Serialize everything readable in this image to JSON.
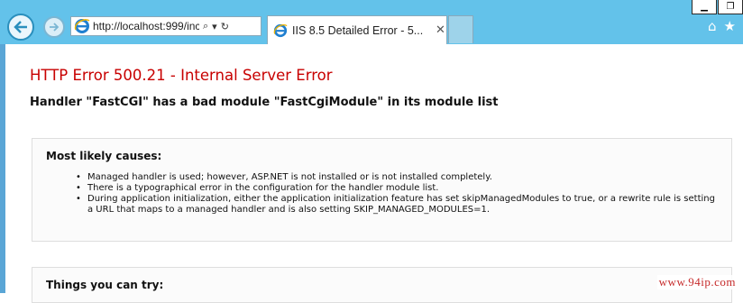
{
  "browser": {
    "window_controls": {
      "minimize": "▁",
      "maximize": "❐"
    },
    "back_icon": "←",
    "forward_icon": "→",
    "address": {
      "url": "http://localhost:999/inc",
      "search_icon": "⌕",
      "dropdown_icon": "▾",
      "refresh_icon": "↻"
    },
    "tab": {
      "title": "IIS 8.5 Detailed Error - 5...",
      "close": "✕"
    },
    "toolbar": {
      "home_icon": "⌂",
      "favorites_icon": "★"
    },
    "accent_color": "#63c2ea"
  },
  "error": {
    "title": "HTTP Error 500.21 - Internal Server Error",
    "title_color": "#c80000",
    "subtitle": "Handler \"FastCGI\" has a bad module \"FastCgiModule\" in its module list"
  },
  "causes": {
    "heading": "Most likely causes:",
    "bullet": "•",
    "items": [
      "Managed handler is used; however, ASP.NET is not installed or is not installed completely.",
      "There is a typographical error in the configuration for the handler module list.",
      "During application initialization, either the application initialization feature has set skipManagedModules to true, or a rewrite rule is setting a URL that maps to a managed handler and is also setting SKIP_MANAGED_MODULES=1."
    ]
  },
  "things": {
    "heading": "Things you can try:"
  },
  "watermark": "www.94ip.com"
}
